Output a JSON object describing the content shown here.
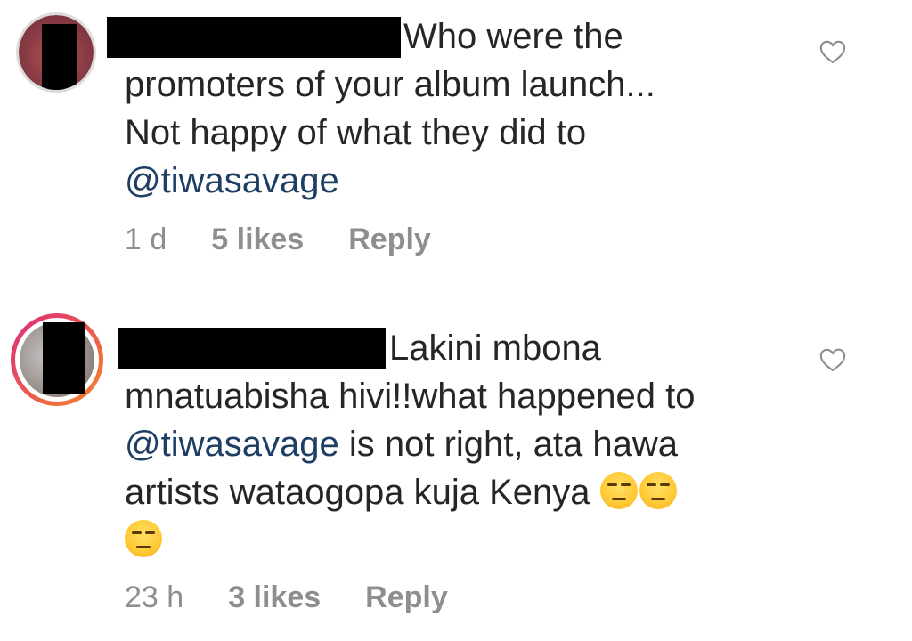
{
  "comments": [
    {
      "text_first": "Who were the",
      "text_rest": "promoters of your album launch...\nNot happy of what they did to",
      "mention": "@tiwasavage",
      "time": "1 d",
      "likes": "5 likes",
      "reply": "Reply",
      "emoji": ""
    },
    {
      "text_first": "Lakini mbona",
      "text_line2": "mnatuabisha hivi!!what happened to",
      "mention": "@tiwasavage",
      "after_mention": " is not right, ata hawa",
      "text_line4": "artists wataogopa kuja Kenya ",
      "emoji": "😒",
      "time": "23 h",
      "likes": "3 likes",
      "reply": "Reply"
    }
  ],
  "colors": {
    "text": "#262626",
    "meta": "#8e8e8e",
    "mention": "#1f3e63",
    "story_ring_start": "#f58529",
    "story_ring_end": "#dd2a7b"
  },
  "icons": {
    "like": "heart-outline-icon"
  }
}
